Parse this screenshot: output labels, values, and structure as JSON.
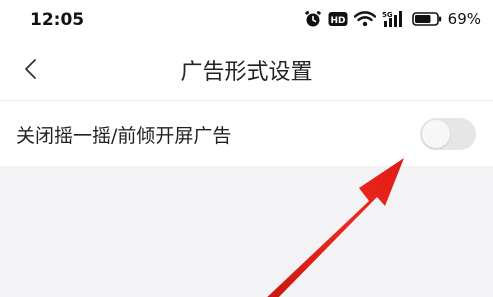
{
  "status_bar": {
    "time": "12:05",
    "battery_percent": "69%",
    "network_label": "5G",
    "hd_label": "HD",
    "icons": [
      "alarm-icon",
      "hd-icon",
      "wifi-icon",
      "signal-5g-icon",
      "battery-icon"
    ]
  },
  "nav": {
    "title": "广告形式设置",
    "back_icon": "chevron-left-icon"
  },
  "settings": [
    {
      "label": "关闭摇一摇/前倾开屏广告",
      "enabled": false
    }
  ],
  "colors": {
    "arrow": "#e8231c",
    "toggle_off": "#e6e6e6"
  }
}
